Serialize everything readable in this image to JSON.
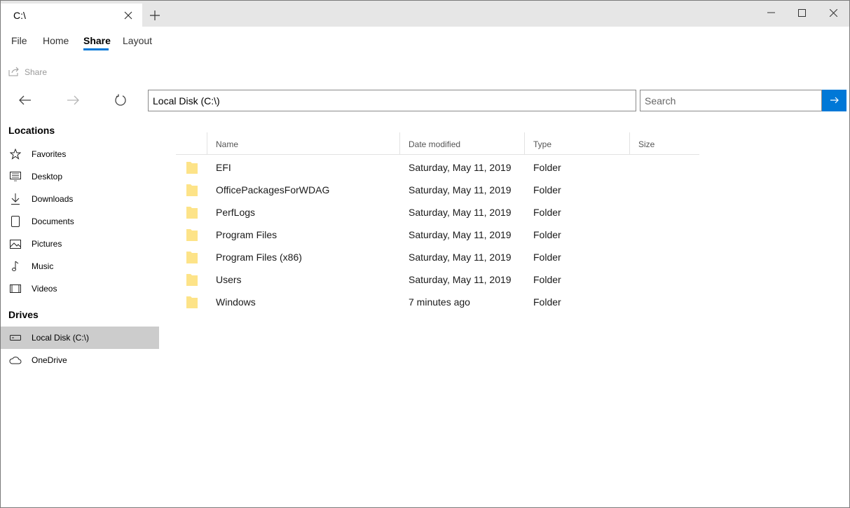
{
  "window": {
    "tab_title": "C:\\",
    "icons": {
      "tab_close": "close-icon",
      "new_tab": "plus-icon",
      "minimize": "minimize-icon",
      "maximize": "maximize-icon",
      "close": "close-icon"
    }
  },
  "ribbon": {
    "tabs": [
      {
        "label": "File"
      },
      {
        "label": "Home"
      },
      {
        "label": "Share",
        "active": true
      },
      {
        "label": "Layout"
      }
    ],
    "commands": {
      "share_label": "Share"
    },
    "accent_color": "#0078d7"
  },
  "navigation": {
    "address": "Local Disk (C:\\)",
    "search_placeholder": "Search",
    "icons": {
      "back": "arrow-left-icon",
      "forward": "arrow-right-icon",
      "refresh": "refresh-icon",
      "go": "arrow-right-icon"
    }
  },
  "sidebar": {
    "locations_header": "Locations",
    "locations": [
      {
        "label": "Favorites",
        "icon": "star-icon"
      },
      {
        "label": "Desktop",
        "icon": "desktop-icon"
      },
      {
        "label": "Downloads",
        "icon": "download-icon"
      },
      {
        "label": "Documents",
        "icon": "document-icon"
      },
      {
        "label": "Pictures",
        "icon": "picture-icon"
      },
      {
        "label": "Music",
        "icon": "music-icon"
      },
      {
        "label": "Videos",
        "icon": "video-icon"
      }
    ],
    "drives_header": "Drives",
    "drives": [
      {
        "label": "Local Disk (C:\\)",
        "icon": "drive-icon",
        "selected": true
      },
      {
        "label": "OneDrive",
        "icon": "cloud-icon"
      }
    ]
  },
  "file_list": {
    "columns": {
      "name": "Name",
      "date": "Date modified",
      "type": "Type",
      "size": "Size"
    },
    "folder_color": "#fde388",
    "rows": [
      {
        "name": "EFI",
        "date": "Saturday, May 11, 2019",
        "type": "Folder",
        "size": ""
      },
      {
        "name": "OfficePackagesForWDAG",
        "date": "Saturday, May 11, 2019",
        "type": "Folder",
        "size": ""
      },
      {
        "name": "PerfLogs",
        "date": "Saturday, May 11, 2019",
        "type": "Folder",
        "size": ""
      },
      {
        "name": "Program Files",
        "date": "Saturday, May 11, 2019",
        "type": "Folder",
        "size": ""
      },
      {
        "name": "Program Files (x86)",
        "date": "Saturday, May 11, 2019",
        "type": "Folder",
        "size": ""
      },
      {
        "name": "Users",
        "date": "Saturday, May 11, 2019",
        "type": "Folder",
        "size": ""
      },
      {
        "name": "Windows",
        "date": "7 minutes ago",
        "type": "Folder",
        "size": ""
      }
    ]
  }
}
